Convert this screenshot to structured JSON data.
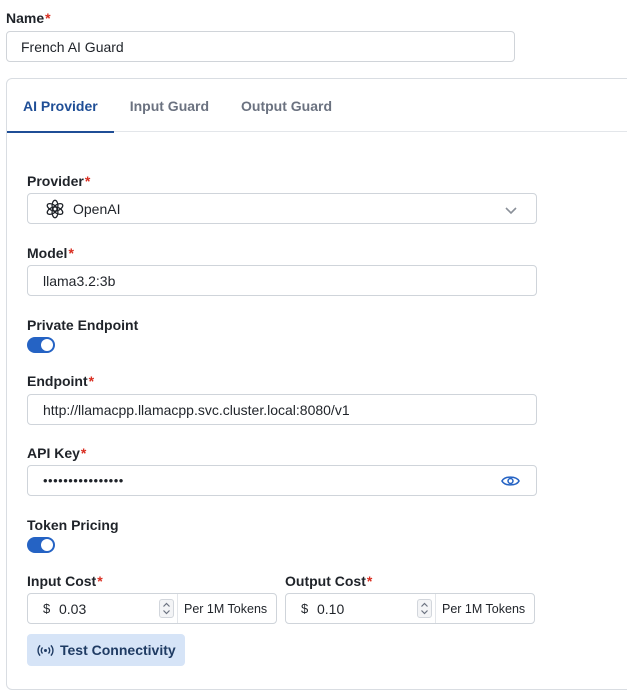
{
  "name": {
    "label": "Name",
    "required_mark": "*",
    "value": "French AI Guard"
  },
  "tabs": [
    {
      "label": "AI Provider",
      "active": true
    },
    {
      "label": "Input Guard",
      "active": false
    },
    {
      "label": "Output Guard",
      "active": false
    }
  ],
  "provider": {
    "label": "Provider",
    "required_mark": "*",
    "value": "OpenAI",
    "icon": "openai-logo-icon"
  },
  "model": {
    "label": "Model",
    "required_mark": "*",
    "value": "llama3.2:3b"
  },
  "private_endpoint": {
    "label": "Private Endpoint",
    "enabled": true
  },
  "endpoint": {
    "label": "Endpoint",
    "required_mark": "*",
    "value": "http://llamacpp.llamacpp.svc.cluster.local:8080/v1"
  },
  "api_key": {
    "label": "API Key",
    "required_mark": "*",
    "masked_value": "••••••••••••••••"
  },
  "token_pricing": {
    "label": "Token Pricing",
    "enabled": true
  },
  "input_cost": {
    "label": "Input Cost",
    "required_mark": "*",
    "currency": "$",
    "value": "0.03",
    "unit": "Per 1M Tokens"
  },
  "output_cost": {
    "label": "Output Cost",
    "required_mark": "*",
    "currency": "$",
    "value": "0.10",
    "unit": "Per 1M Tokens"
  },
  "test_button": {
    "label": "Test Connectivity",
    "icon": "broadcast-icon"
  },
  "colors": {
    "accent": "#1f4e96",
    "toggle": "#2563c4",
    "required": "#d92d20",
    "button_bg": "#d6e4f7"
  }
}
